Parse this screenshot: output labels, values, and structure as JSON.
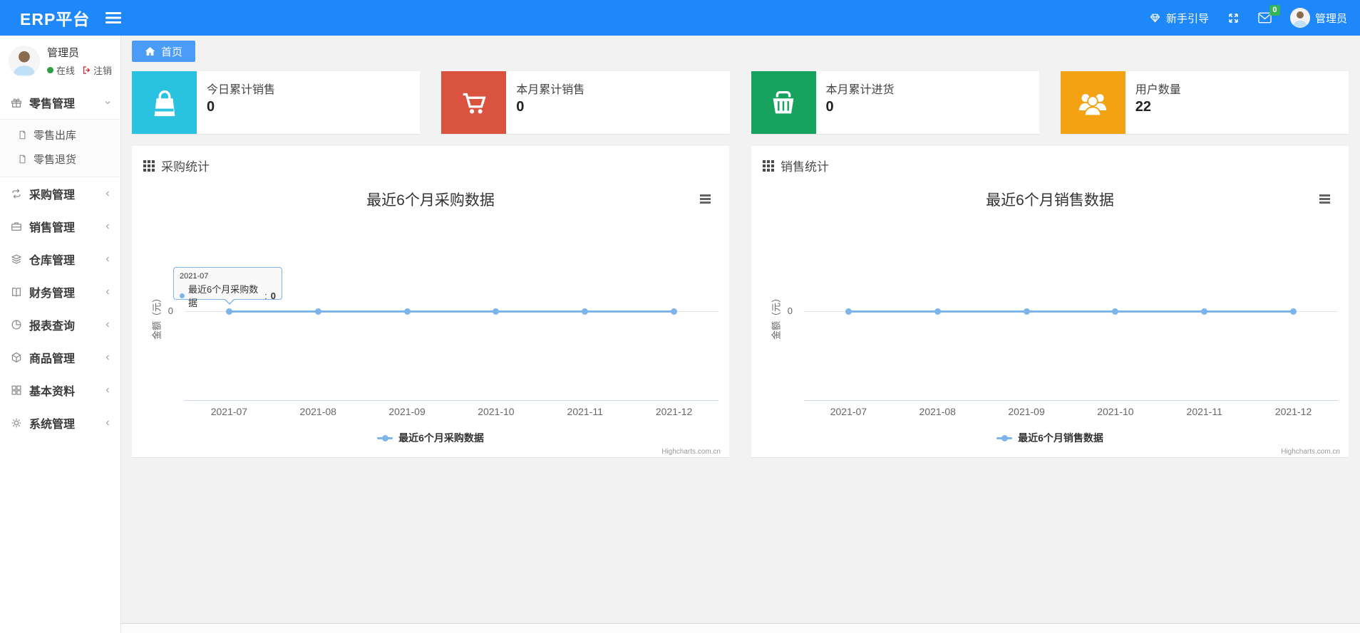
{
  "navbar": {
    "brand": "ERP平台",
    "guide_label": "新手引导",
    "mail_badge": "0",
    "username": "管理员"
  },
  "sidebar": {
    "user": {
      "name": "管理员",
      "status_online": "在线",
      "logout_label": "注销"
    },
    "menu": [
      {
        "label": "零售管理",
        "icon": "gift-icon",
        "expanded": true,
        "children": [
          {
            "label": "零售出库",
            "icon": "document-icon"
          },
          {
            "label": "零售退货",
            "icon": "document-icon"
          }
        ]
      },
      {
        "label": "采购管理",
        "icon": "exchange-icon"
      },
      {
        "label": "销售管理",
        "icon": "briefcase-icon"
      },
      {
        "label": "仓库管理",
        "icon": "layers-icon"
      },
      {
        "label": "财务管理",
        "icon": "book-icon"
      },
      {
        "label": "报表查询",
        "icon": "pie-chart-icon"
      },
      {
        "label": "商品管理",
        "icon": "cube-icon"
      },
      {
        "label": "基本资料",
        "icon": "grid-icon"
      },
      {
        "label": "系统管理",
        "icon": "gear-icon"
      }
    ]
  },
  "tabs": {
    "home_label": "首页"
  },
  "stat_cards": [
    {
      "label": "今日累计销售",
      "value": "0",
      "color": "#29c2e1",
      "icon": "shopping-bag-icon"
    },
    {
      "label": "本月累计销售",
      "value": "0",
      "color": "#d9533f",
      "icon": "shopping-cart-icon"
    },
    {
      "label": "本月累计进货",
      "value": "0",
      "color": "#17a35d",
      "icon": "shopping-basket-icon"
    },
    {
      "label": "用户数量",
      "value": "22",
      "color": "#f3a214",
      "icon": "users-icon"
    }
  ],
  "chart_data": [
    {
      "type": "line",
      "panel_title": "采购统计",
      "title": "最近6个月采购数据",
      "categories": [
        "2021-07",
        "2021-08",
        "2021-09",
        "2021-10",
        "2021-11",
        "2021-12"
      ],
      "series": [
        {
          "name": "最近6个月采购数据",
          "values": [
            0,
            0,
            0,
            0,
            0,
            0
          ]
        }
      ],
      "xlabel": "",
      "ylabel": "金额（元）",
      "y_ticks": [
        "0"
      ],
      "ylim": [
        0,
        1
      ],
      "grid": false,
      "legend_position": "bottom",
      "line_color": "#7cb5ec",
      "credits": "Highcharts.com.cn",
      "tooltip": {
        "header": "2021-07",
        "series_name": "最近6个月采购数据",
        "separator": ": ",
        "value": "0"
      }
    },
    {
      "type": "line",
      "panel_title": "销售统计",
      "title": "最近6个月销售数据",
      "categories": [
        "2021-07",
        "2021-08",
        "2021-09",
        "2021-10",
        "2021-11",
        "2021-12"
      ],
      "series": [
        {
          "name": "最近6个月销售数据",
          "values": [
            0,
            0,
            0,
            0,
            0,
            0
          ]
        }
      ],
      "xlabel": "",
      "ylabel": "金额（元）",
      "y_ticks": [
        "0"
      ],
      "ylim": [
        0,
        1
      ],
      "grid": false,
      "legend_position": "bottom",
      "line_color": "#7cb5ec",
      "credits": "Highcharts.com.cn"
    }
  ]
}
